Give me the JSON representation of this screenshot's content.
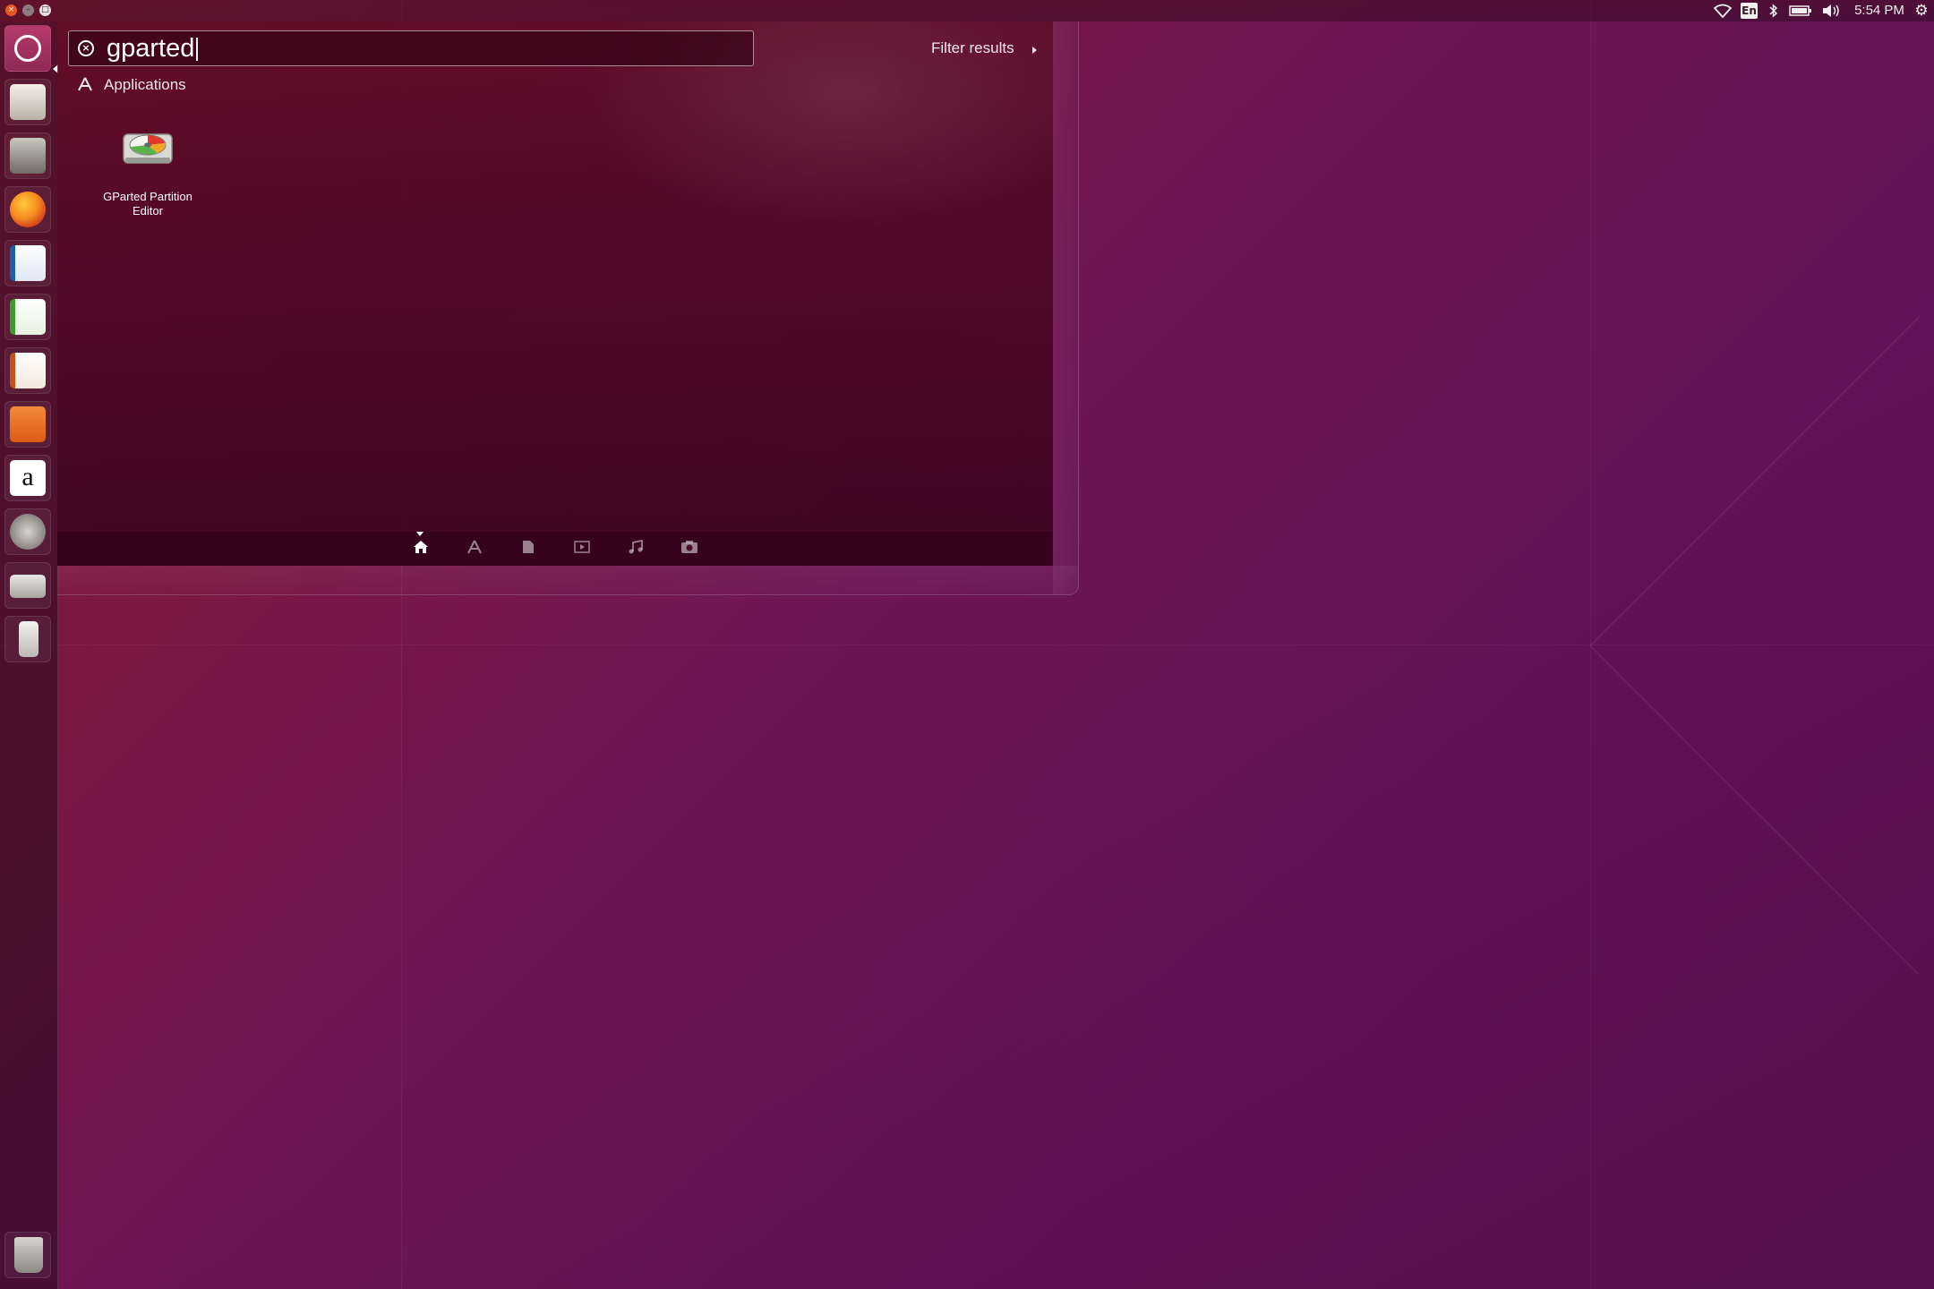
{
  "top_panel": {
    "window_controls": {
      "close": "×",
      "minimize": "–",
      "maximize": "□"
    },
    "keyboard_layout": "En",
    "clock": "5:54 PM",
    "icons": [
      "wifi-icon",
      "keyboard-layout-indicator",
      "bluetooth-icon",
      "battery-icon",
      "volume-icon",
      "system-gear-icon"
    ]
  },
  "launcher": {
    "items": [
      "dash-home",
      "install-ubuntu",
      "files",
      "firefox",
      "libreoffice-writer",
      "libreoffice-calc",
      "libreoffice-impress",
      "ubuntu-software",
      "amazon",
      "system-settings",
      "drive",
      "usb-drive",
      "trash"
    ],
    "amazon_glyph": "a"
  },
  "dash": {
    "search": {
      "value": "gparted",
      "placeholder": ""
    },
    "filter_results_label": "Filter results",
    "category": {
      "label": "Applications"
    },
    "results": [
      {
        "label": "GParted Partition Editor",
        "icon": "gparted-icon"
      }
    ],
    "lenses": [
      "home",
      "applications",
      "files",
      "video",
      "music",
      "photos"
    ],
    "active_lens": "home"
  },
  "colors": {
    "accent": "#e95420",
    "background_top": "#8c1b38",
    "background_bottom": "#5e1257"
  }
}
